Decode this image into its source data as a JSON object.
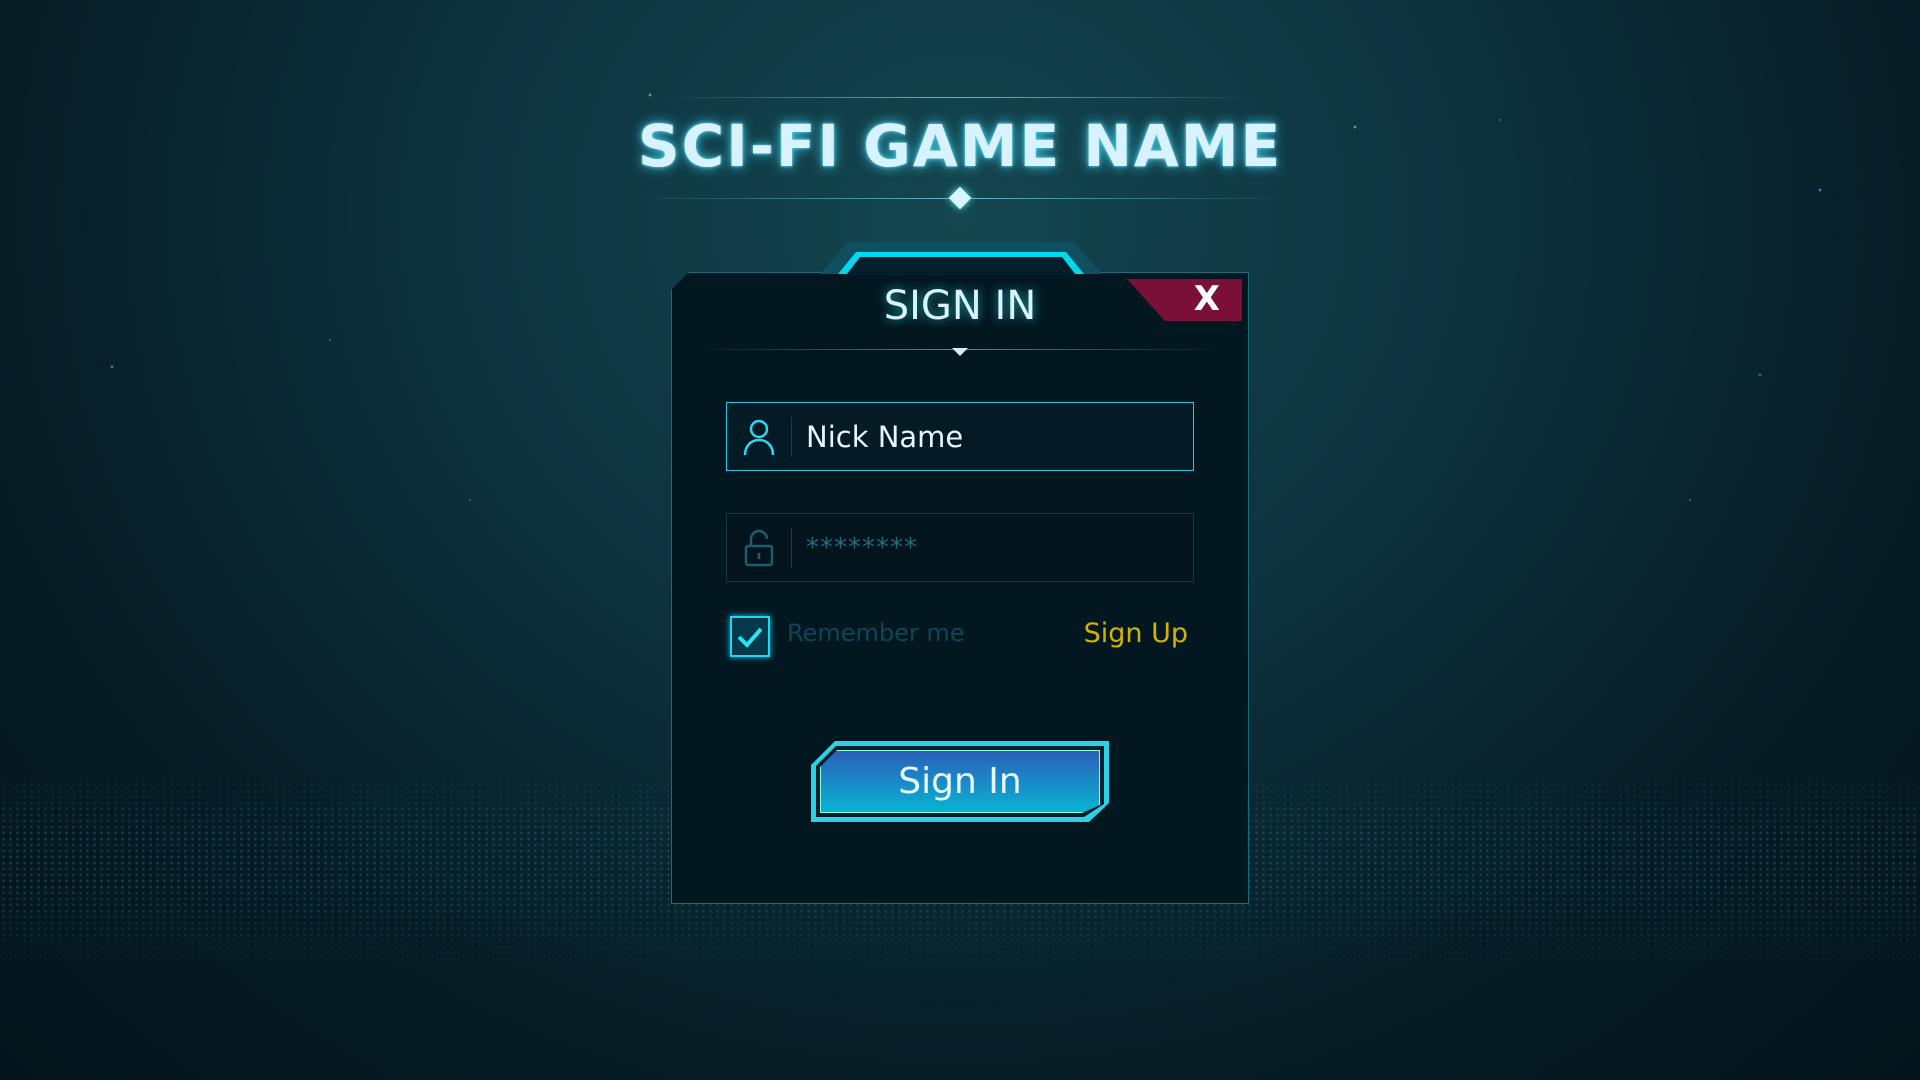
{
  "header": {
    "game_title": "SCI-FI GAME NAME"
  },
  "dialog": {
    "title": "SIGN IN",
    "close_label": "X",
    "nickname": {
      "value": "Nick Name",
      "icon": "user-icon"
    },
    "password": {
      "value": "********",
      "icon": "lock-icon"
    },
    "remember": {
      "label": "Remember me",
      "checked": true
    },
    "signup_label": "Sign Up",
    "signin_label": "Sign In"
  },
  "colors": {
    "accent": "#00d8f0",
    "close": "#7a1038",
    "signup": "#d3b200"
  }
}
